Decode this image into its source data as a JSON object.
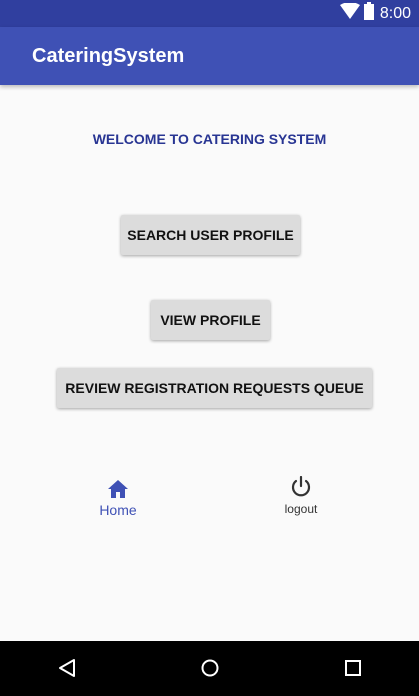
{
  "status_bar": {
    "time": "8:00"
  },
  "app_bar": {
    "title": "CateringSystem"
  },
  "main": {
    "welcome": "WELCOME TO CATERING SYSTEM",
    "buttons": {
      "search_user_profile": "SEARCH USER PROFILE",
      "view_profile": "VIEW PROFILE",
      "review_registration": "REVIEW REGISTRATION REQUESTS QUEUE"
    }
  },
  "bottom_nav": {
    "home": {
      "label": "Home",
      "icon": "home-icon",
      "color": "#3f51b5"
    },
    "logout": {
      "label": "logout",
      "icon": "power-icon"
    }
  },
  "colors": {
    "primary": "#3f51b5",
    "primary_dark": "#303f9f",
    "welcome_text": "#283593"
  }
}
